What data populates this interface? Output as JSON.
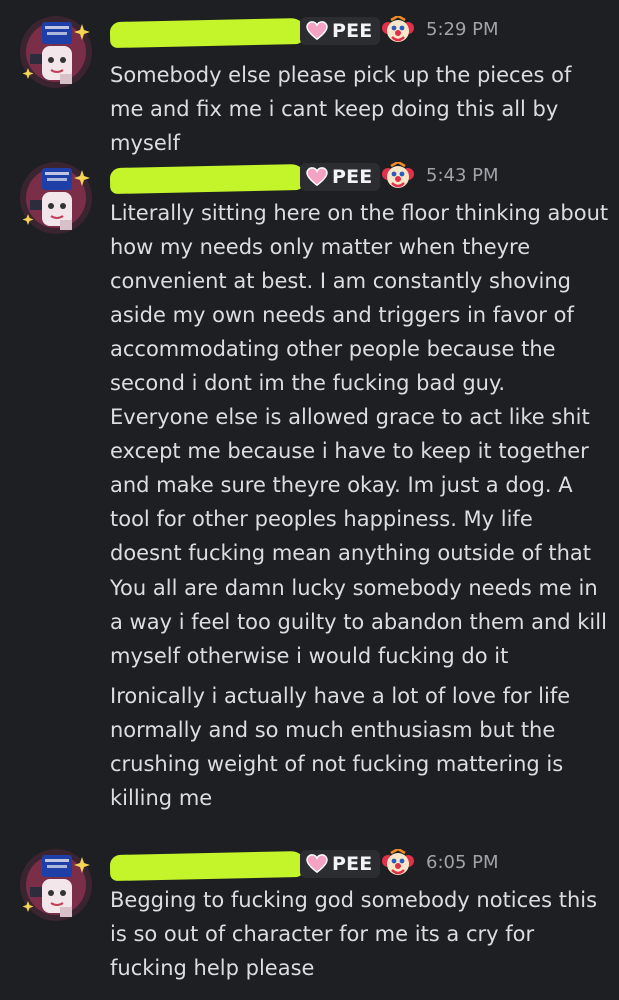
{
  "colors": {
    "background": "#1e1f22",
    "text": "#dbdee1",
    "timestamp": "#a0a3aa",
    "redaction": "#c3f52a",
    "tag_bg": "#2b2d31"
  },
  "messages": [
    {
      "tag": "PEE",
      "tag_icon": "pink-heart-icon",
      "badge_icon": "clown-face-icon",
      "time": "5:29 PM",
      "paragraphs": [
        "Somebody else please pick up the pieces of me and fix me i cant keep doing this all by myself"
      ]
    },
    {
      "tag": "PEE",
      "tag_icon": "pink-heart-icon",
      "badge_icon": "clown-face-icon",
      "time": "5:43 PM",
      "paragraphs": [
        "Literally sitting here on the floor thinking about how my needs only matter when theyre convenient at best. I am constantly shoving aside my own needs and triggers in favor of accommodating other people because the second i dont im the fucking bad guy. Everyone else is allowed grace to act like shit except me because i have to keep it together and make sure theyre okay. Im just a dog. A tool for other peoples happiness. My life doesnt fucking mean anything outside of that",
        "You all are damn lucky somebody needs me in a way i feel too guilty to abandon them and kill myself otherwise i would fucking do it",
        "Ironically i actually have a lot of love for life normally and so much enthusiasm but the crushing weight of not fucking mattering is killing me"
      ]
    },
    {
      "tag": "PEE",
      "tag_icon": "pink-heart-icon",
      "badge_icon": "clown-face-icon",
      "time": "6:05 PM",
      "paragraphs": [
        "Begging to fucking god somebody notices this is so out of character for me its a cry for fucking help please"
      ]
    }
  ]
}
